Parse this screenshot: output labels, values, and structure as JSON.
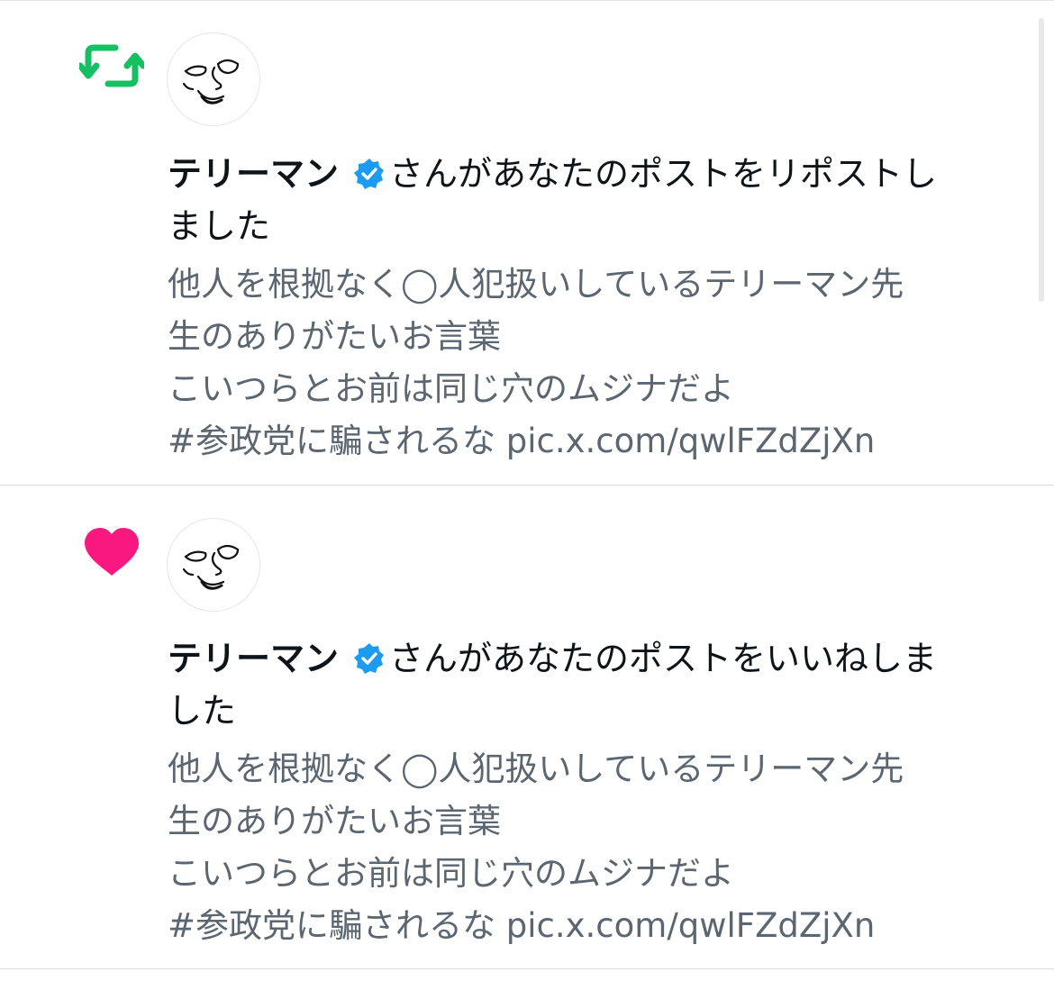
{
  "notifications": [
    {
      "type": "repost",
      "icon": "repost-icon",
      "icon_color": "#17bf63",
      "user_name": "テリーマン",
      "verified": true,
      "action_text_1": "さんがあなたのポストをリポストし",
      "action_text_2": "ました",
      "post_lines": [
        "他人を根拠なく◯人犯扱いしているテリーマン先",
        "生のありがたいお言葉",
        "こいつらとお前は同じ穴のムジナだよ",
        "#参政党に騙されるな pic.x.com/qwlFZdZjXn"
      ]
    },
    {
      "type": "like",
      "icon": "heart-icon",
      "icon_color": "#f91880",
      "user_name": "テリーマン",
      "verified": true,
      "action_text_1": "さんがあなたのポストをいいねしま",
      "action_text_2": "した",
      "post_lines": [
        "他人を根拠なく◯人犯扱いしているテリーマン先",
        "生のありがたいお言葉",
        "こいつらとお前は同じ穴のムジナだよ",
        "#参政党に騙されるな pic.x.com/qwlFZdZjXn"
      ]
    }
  ],
  "colors": {
    "verified_badge": "#1d9bf0",
    "name_text": "#0f1419",
    "post_text": "#5b6670",
    "divider": "#dadde1"
  }
}
